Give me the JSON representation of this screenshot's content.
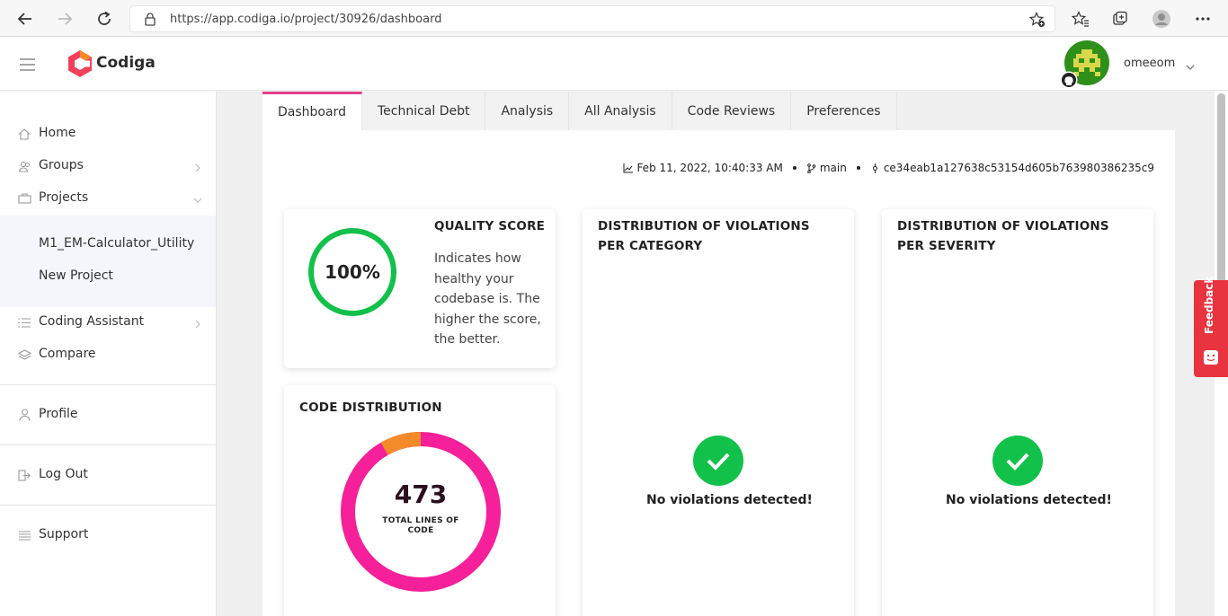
{
  "browser": {
    "url": "https://app.codiga.io/project/30926/dashboard"
  },
  "header": {
    "brand": "Codiga",
    "username": "omeeom"
  },
  "sidebar": {
    "items": [
      {
        "label": "Home",
        "icon": "home-icon"
      },
      {
        "label": "Groups",
        "icon": "groups-icon"
      },
      {
        "label": "Projects",
        "icon": "projects-icon"
      },
      {
        "label": "M1_EM-Calculator_Utility"
      },
      {
        "label": "New Project"
      },
      {
        "label": "Coding Assistant",
        "icon": "list-icon"
      },
      {
        "label": "Compare",
        "icon": "layers-icon"
      },
      {
        "label": "Profile",
        "icon": "user-icon"
      },
      {
        "label": "Log Out",
        "icon": "logout-icon"
      },
      {
        "label": "Support",
        "icon": "lines-icon"
      }
    ]
  },
  "tabs": [
    {
      "label": "Dashboard",
      "active": true
    },
    {
      "label": "Technical Debt"
    },
    {
      "label": "Analysis"
    },
    {
      "label": "All Analysis"
    },
    {
      "label": "Code Reviews"
    },
    {
      "label": "Preferences"
    }
  ],
  "meta": {
    "date": "Feb 11, 2022, 10:40:33 AM",
    "branch": "main",
    "commit": "ce34eab1a127638c53154d605b763980386235c9"
  },
  "quality": {
    "title": "QUALITY SCORE",
    "score": "100%",
    "score_value": 100,
    "description": "Indicates how healthy your codebase is. The higher the score, the better."
  },
  "code_distribution": {
    "title": "CODE DISTRIBUTION",
    "total": "473",
    "total_label": "TOTAL LINES OF CODE"
  },
  "violations_category": {
    "title": "DISTRIBUTION OF VIOLATIONS PER CATEGORY",
    "message": "No violations detected!"
  },
  "violations_severity": {
    "title": "DISTRIBUTION OF VIOLATIONS PER SEVERITY",
    "message": "No violations detected!"
  },
  "feedback": {
    "label": "Feedback"
  },
  "colors": {
    "accent": "#e83e8c",
    "success": "#11c14a",
    "donut_primary": "#f5209a",
    "donut_secondary": "#f58a2a",
    "feedback": "#e8343f"
  }
}
